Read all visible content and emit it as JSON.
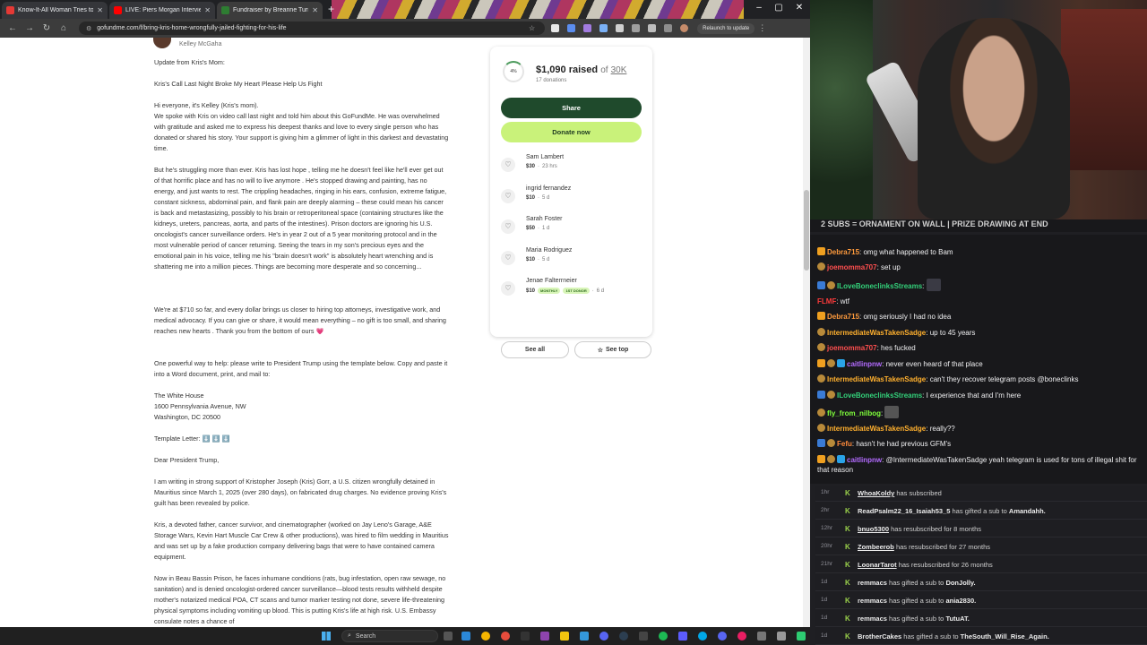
{
  "browser": {
    "tabs": [
      {
        "label": "Know-It-All Woman Tries to Lo",
        "favicon_color": "#e53935"
      },
      {
        "label": "LIVE: Piers Morgan Interviews",
        "favicon_color": "#ff0000"
      },
      {
        "label": "Fundraiser by Breanne Turner",
        "favicon_color": "#2e7d32"
      }
    ],
    "new_tab": "+",
    "url": "gofundme.com/f/bring-kris-home-wrongfully-jailed-fighting-for-his-life",
    "relaunch_label": "Relaunch to update"
  },
  "story": {
    "author": "Kelley McGaha",
    "paragraphs": [
      "Update from Kris's Mom:",
      "Kris's Call Last Night Broke My Heart Please Help Us Fight",
      "Hi everyone, it's Kelley (Kris's mom).\nWe spoke with Kris on video call last night and told him about this GoFundMe. He was overwhelmed with gratitude and asked me to express his deepest thanks and love to every single person who has donated or shared his story. Your support is giving him a glimmer of light in this darkest and devastating time.",
      "But he's struggling more than ever. Kris has lost hope , telling me he doesn't feel like he'll ever get out of that horrific place and has no will to live anymore . He's stopped drawing and painting, has no energy, and just wants to rest. The crippling headaches, ringing in his ears, confusion, extreme fatigue, constant sickness, abdominal pain, and flank pain are deeply alarming – these could mean his cancer is back and metastasizing, possibly to his brain or retroperitoneal space (containing structures like the kidneys, ureters, pancreas, aorta, and parts of the intestines). Prison doctors are ignoring his U.S. oncologist's cancer surveillance orders. He's in year 2 out of a 5 year monitoring protocol and in the most vulnerable period of cancer returning. Seeing the tears in my son's precious eyes and the emotional pain in his voice, telling me his \"brain doesn't work\" is absolutely heart wrenching and is shattering me into a million pieces. Things are becoming more desperate and so concerning...",
      "We're at $710 so far, and every dollar brings us closer to hiring top attorneys, investigative work, and medical advocacy. If you can give or share, it would mean everything – no gift is too small, and sharing reaches new hearts . Thank you from the bottom of ours",
      "One powerful way to help: please write to President Trump using the template below. Copy and paste it into a Word document, print, and mail to:",
      "The White House\n1600 Pennsylvania Avenue, NW\nWashington, DC 20500",
      "Template Letter:",
      "Dear President Trump,",
      "I am writing in strong support of Kristopher Joseph (Kris) Gorr, a U.S. citizen wrongfully detained in Mauritius since March 1, 2025 (over 280 days), on fabricated drug charges. No evidence proving Kris's guilt has been revealed by police.",
      "Kris, a devoted father, cancer survivor, and cinematographer (worked on Jay Leno's Garage, A&E Storage Wars, Kevin Hart Muscle Car Crew & other productions), was hired to film wedding in Mauritius and was set up by a fake production company delivering bags that were to have contained camera equipment.",
      "Now in Beau Bassin Prison, he faces inhumane conditions (rats, bug infestation, open raw sewage, no sanitation) and is denied oncologist-ordered cancer surveillance—blood tests results withheld despite mother's notarized medical POA, CT scans and tumor marker testing not done, severe life-threatening physical symptoms including vomiting up blood. This is putting Kris's life at high risk. U.S. Embassy consulate notes a chance of"
    ],
    "heart_glyph": "💗",
    "template_arrows": "⬇️ ⬇️ ⬇️"
  },
  "card": {
    "progress_percent": "4%",
    "progress_value": 0.04,
    "raised": "$1,090 raised",
    "of_label": "of",
    "goal": "30K",
    "donation_count": "17 donations",
    "share_label": "Share",
    "donate_label": "Donate now",
    "donors": [
      {
        "name": "Sam Lambert",
        "amount": "$30",
        "ago": "23 hrs"
      },
      {
        "name": "ingrid fernandez",
        "amount": "$10",
        "ago": "5 d"
      },
      {
        "name": "Sarah Foster",
        "amount": "$50",
        "ago": "1 d"
      },
      {
        "name": "Maria Rodriguez",
        "amount": "$10",
        "ago": "5 d"
      },
      {
        "name": "Jenae Falterrneier",
        "amount": "$10",
        "badge1": "MONTHLY",
        "badge2": "1ST DONOR",
        "ago": "6 d"
      }
    ],
    "see_all_label": "See all",
    "see_top_label": "See top",
    "accent_green": "#1f4a2c",
    "accent_lime": "#c9f27a"
  },
  "taskbar": {
    "search_placeholder": "Search"
  },
  "stream": {
    "banner": "2 SUBS = ORNAMENT ON WALL | PRIZE DRAWING AT END",
    "chat": [
      {
        "user": "Debra715",
        "color": "#ff9b3d",
        "text": "omg what happened to Bam"
      },
      {
        "user": "joemomma707",
        "color": "#ff4f4f",
        "text": "set up"
      },
      {
        "user": "ILoveBoneclinksStreams",
        "color": "#33d17a",
        "text": ""
      },
      {
        "user": "FLMF",
        "color": "#ff3b3b",
        "text": "wtf"
      },
      {
        "user": "Debra715",
        "color": "#ff9b3d",
        "text": "omg seriously I had no idea"
      },
      {
        "user": "IntermediateWasTakenSadge",
        "color": "#ffb02e",
        "text": "up to 45 years"
      },
      {
        "user": "joemomma707",
        "color": "#ff4f4f",
        "text": "hes fucked"
      },
      {
        "user": "caitlinpnw",
        "color": "#b36bff",
        "text": "never even heard of that place"
      },
      {
        "user": "IntermediateWasTakenSadge",
        "color": "#ffb02e",
        "text": "can't they recover telegram posts @boneclinks"
      },
      {
        "user": "ILoveBoneclinksStreams",
        "color": "#33d17a",
        "text": "I experience that and I'm here"
      },
      {
        "user": "fly_from_nilbog",
        "color": "#7fff3b",
        "text": ""
      },
      {
        "user": "IntermediateWasTakenSadge",
        "color": "#ffb02e",
        "text": "really??"
      },
      {
        "user": "Fefu",
        "color": "#ff8a3b",
        "text": "hasn't he had previous GFM's"
      },
      {
        "user": "caitlinpnw",
        "color": "#b36bff",
        "text": "@IntermediateWasTakenSadge yeah telegram is used for tons of illegal shit for that reason"
      }
    ],
    "events": [
      {
        "ago": "1hr",
        "name": "WhoaKoldy",
        "text": "has subscribed",
        "underline": true
      },
      {
        "ago": "2hr",
        "name": "ReadPsalm22_16_Isaiah53_5",
        "text": "has gifted a sub to",
        "target": "Amandahh."
      },
      {
        "ago": "12hr",
        "name": "bnuo5300",
        "text": "has resubscribed for 8 months",
        "underline": true
      },
      {
        "ago": "20hr",
        "name": "Zombeerob",
        "text": "has resubscribed for 27 months",
        "underline": true
      },
      {
        "ago": "21hr",
        "name": "LoonarTarot",
        "text": "has resubscribed for 26 months",
        "underline": true
      },
      {
        "ago": "1d",
        "name": "remmacs",
        "text": "has gifted a sub to",
        "target": "DonJolly."
      },
      {
        "ago": "1d",
        "name": "remmacs",
        "text": "has gifted a sub to",
        "target": "ania2830."
      },
      {
        "ago": "1d",
        "name": "remmacs",
        "text": "has gifted a sub to",
        "target": "TutuAT."
      },
      {
        "ago": "1d",
        "name": "BrotherCakes",
        "text": "has gifted a sub to",
        "target": "TheSouth_Will_Rise_Again."
      }
    ]
  }
}
